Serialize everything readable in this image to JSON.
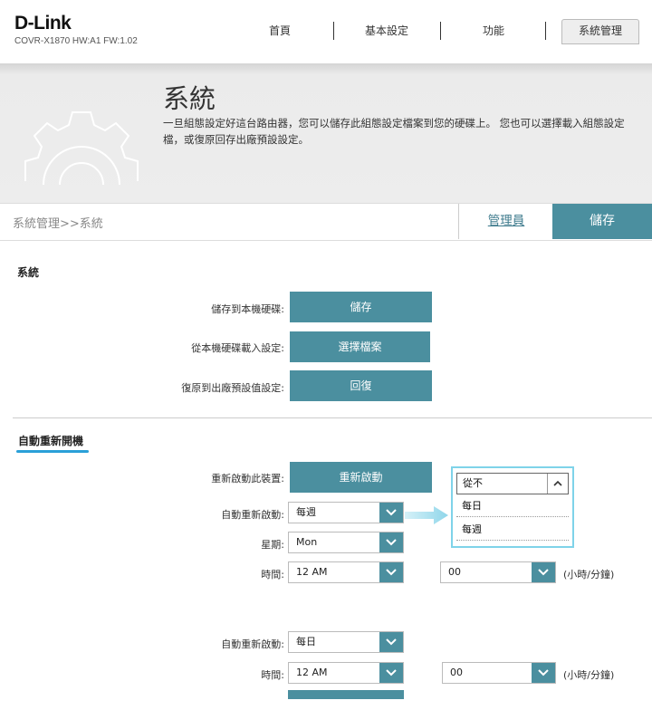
{
  "header": {
    "logo": "D-Link",
    "model": "COVR-X1870 HW:A1 FW:1.02",
    "nav": [
      {
        "label": "首頁"
      },
      {
        "label": "基本設定"
      },
      {
        "label": "功能"
      },
      {
        "label": "系統管理"
      }
    ]
  },
  "banner": {
    "title": "系統",
    "description": "一旦組態設定好這台路由器，您可以儲存此組態設定檔案到您的硬碟上。 您也可以選擇載入組態設定檔，或復原回存出廠預設設定。"
  },
  "breadcrumb": "系統管理>>系統",
  "tabs": {
    "admin": "管理員",
    "save": "儲存"
  },
  "system": {
    "title": "系統",
    "rows": [
      {
        "label": "儲存到本機硬碟:",
        "button": "儲存"
      },
      {
        "label": "從本機硬碟載入設定:",
        "button": "選擇檔案"
      },
      {
        "label": "復原到出廠預設值設定:",
        "button": "回復"
      }
    ]
  },
  "reboot": {
    "title": "自動重新開機",
    "reboot_label": "重新啟動此裝置:",
    "reboot_button": "重新啟動",
    "weekly": {
      "auto_label": "自動重新啟動:",
      "auto_value": "每週",
      "day_label": "星期:",
      "day_value": "Mon",
      "time_label": "時間:",
      "hour_value": "12 AM",
      "minute_value": "00",
      "unit": "(小時/分鐘)"
    },
    "daily": {
      "auto_label": "自動重新啟動:",
      "auto_value": "每日",
      "time_label": "時間:",
      "hour_value": "12 AM",
      "minute_value": "00",
      "unit": "(小時/分鐘)"
    },
    "dropdown": {
      "selected": "從不",
      "options": [
        "每日",
        "每週"
      ]
    }
  },
  "colors": {
    "accent": "#4b8f9f",
    "highlight": "#7fd3e9",
    "underline": "#2aa0d8"
  }
}
